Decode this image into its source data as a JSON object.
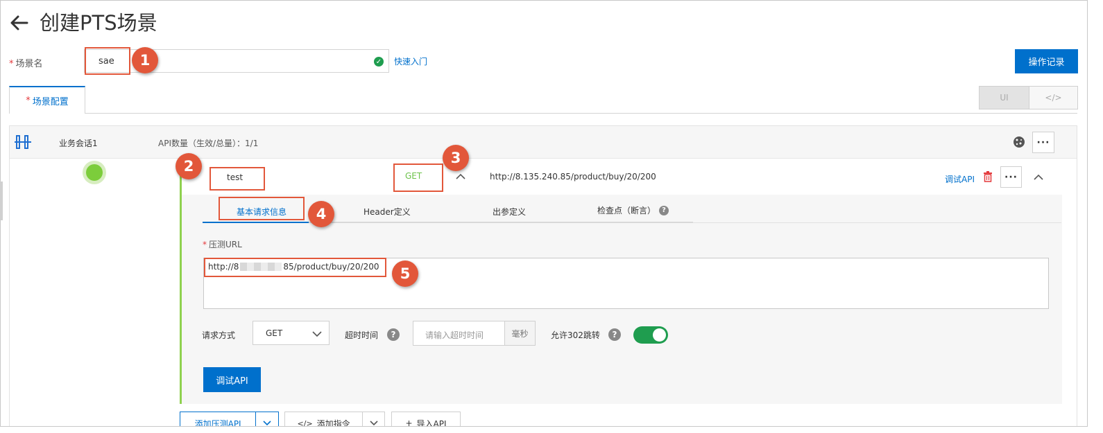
{
  "header": {
    "back_icon": "arrow-left-icon",
    "title": "创建PTS场景"
  },
  "scene_name": {
    "label": "场景名",
    "value": "sae",
    "quick_start": "快速入门",
    "op_log": "操作记录"
  },
  "tabs": {
    "scene_config": "场景配置",
    "ui": "UI",
    "code": "</>"
  },
  "session": {
    "name": "业务会话1",
    "api_count": "API数量（生效/总量）：1/1"
  },
  "api": {
    "name": "test",
    "method": "GET",
    "url": "http://8.135.240.85/product/buy/20/200",
    "debug_link": "调试API"
  },
  "subtabs": [
    "基本请求信息",
    "Header定义",
    "出参定义",
    "检查点（断言）"
  ],
  "form": {
    "url_label": "压测URL",
    "url_value": "http://8     85/product/buy/20/200",
    "method_label": "请求方式",
    "method_value": "GET",
    "timeout_label": "超时时间",
    "timeout_placeholder": "请输入超时时间",
    "timeout_unit": "毫秒",
    "redirect_label": "允许302跳转",
    "debug_button": "调试API"
  },
  "bottom": {
    "add_pressure_api": "添加压测API",
    "add_instruction": "添加指令",
    "import_api": "导入API"
  },
  "annotations": [
    "1",
    "2",
    "3",
    "4",
    "5"
  ],
  "colors": {
    "primary": "#0070cc",
    "success": "#3bb346",
    "annotation": "#e2573a",
    "green_rail": "#8fd14f"
  }
}
